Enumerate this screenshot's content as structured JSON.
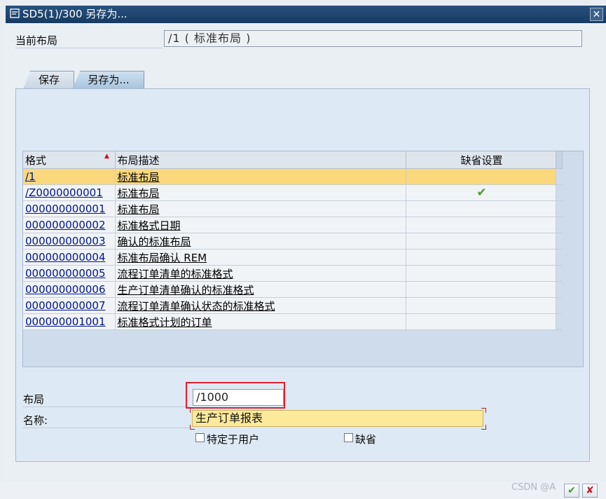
{
  "window": {
    "title": "SD5(1)/300 另存为...",
    "close_symbol": "✕"
  },
  "current_layout": {
    "label": "当前布局",
    "value": "/1 ( 标准布局 )"
  },
  "tabs": [
    {
      "label": "保存",
      "active": false
    },
    {
      "label": "另存为...",
      "active": true
    }
  ],
  "table": {
    "columns": [
      "格式",
      "布局描述",
      "缺省设置"
    ],
    "rows": [
      {
        "format": "/1",
        "description": "标准布局",
        "default": "",
        "selected": true
      },
      {
        "format": "/Z0000000001",
        "description": "标准布局",
        "default": "✔",
        "selected": false
      },
      {
        "format": "000000000001",
        "description": "标准布局",
        "default": "",
        "selected": false
      },
      {
        "format": "000000000002",
        "description": "标准格式日期",
        "default": "",
        "selected": false
      },
      {
        "format": "000000000003",
        "description": "确认的标准布局",
        "default": "",
        "selected": false
      },
      {
        "format": "000000000004",
        "description": "标准布局确认 REM",
        "default": "",
        "selected": false
      },
      {
        "format": "000000000005",
        "description": "流程订单清单的标准格式",
        "default": "",
        "selected": false
      },
      {
        "format": "000000000006",
        "description": "生产订单清单确认的标准格式",
        "default": "",
        "selected": false
      },
      {
        "format": "000000000007",
        "description": "流程订单清单确认状态的标准格式",
        "default": "",
        "selected": false
      },
      {
        "format": "000000001001",
        "description": "标准格式计划的订单",
        "default": "",
        "selected": false
      }
    ]
  },
  "form": {
    "layout_label": "布局",
    "layout_value": "/1000",
    "name_label": "名称:",
    "name_value": "生产订单报表",
    "user_specific_label": "特定于用户",
    "default_label": "缺省"
  },
  "footer": {
    "confirm_symbol": "✔",
    "cancel_symbol": "✘",
    "watermark": "CSDN @A"
  },
  "colors": {
    "titlebar": "#1f4a74",
    "selected_row": "#fbd87b",
    "name_field": "#fde99a",
    "highlight_box": "#e0202e",
    "check": "#4a9a2a"
  }
}
